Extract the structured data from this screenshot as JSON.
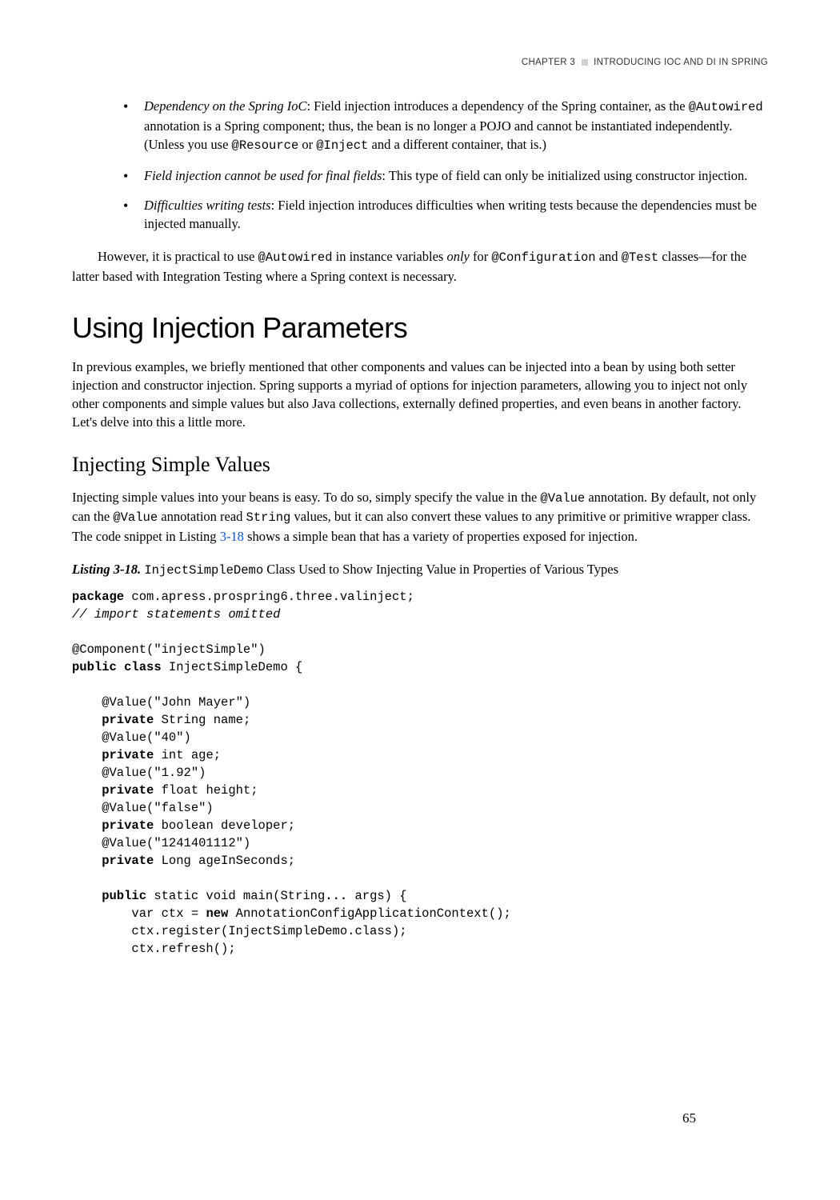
{
  "header": {
    "chapter_prefix": "CHAPTER 3",
    "chapter_title": "INTRODUCING IOC AND DI IN SPRING"
  },
  "bullets": [
    {
      "term": "Dependency on the Spring IoC",
      "text_before_code1": ": Field injection introduces a dependency of the Spring container, as the ",
      "code1": "@Autowired",
      "text_mid": " annotation is a Spring component; thus, the bean is no longer a POJO and cannot be instantiated independently. (Unless you use ",
      "code2": "@Resource",
      "text_mid2": " or ",
      "code3": "@Inject",
      "text_after": " and a different container, that is.)"
    },
    {
      "term": "Field injection cannot be used for final fields",
      "text_after": ": This type of field can only be initialized using constructor injection."
    },
    {
      "term": "Difficulties writing tests",
      "text_after": ": Field injection introduces difficulties when writing tests because the dependencies must be injected manually."
    }
  ],
  "para1": {
    "t1": "However, it is practical to use ",
    "c1": "@Autowired",
    "t2": " in instance variables ",
    "i1": "only",
    "t3": " for ",
    "c2": "@Configuration",
    "t4": " and ",
    "c3": "@Test",
    "t5": " classes—for the latter based with Integration Testing where a Spring context is necessary."
  },
  "h1": "Using Injection Parameters",
  "para2": "In previous examples, we briefly mentioned that other components and values can be injected into a bean by using both setter injection and constructor injection. Spring supports a myriad of options for injection parameters, allowing you to inject not only other components and simple values but also Java collections, externally defined properties, and even beans in another factory. Let's delve into this a little more.",
  "h2": "Injecting Simple Values",
  "para3": {
    "t1": "Injecting simple values into your beans is easy. To do so, simply specify the value in the ",
    "c1": "@Value",
    "t2": " annotation. By default, not only can the ",
    "c2": "@Value",
    "t3": " annotation read ",
    "c3": "String",
    "t4": " values, but it can also convert these values to any primitive or primitive wrapper class. The code snippet in Listing ",
    "link": "3-18",
    "t5": " shows a simple bean that has a variety of properties exposed for injection."
  },
  "listing": {
    "label": "Listing 3-18.",
    "code_class": "InjectSimpleDemo",
    "caption_rest": " Class Used to Show Injecting Value in Properties of Various Types"
  },
  "code": {
    "l1a": "package",
    "l1b": " com.apress.prospring6.three.valinject;",
    "l2": "// import statements omitted",
    "l3": "@Component(\"injectSimple\")",
    "l4a": "public class",
    "l4b": " InjectSimpleDemo {",
    "l5": "    @Value(\"John Mayer\")",
    "l6a": "    private",
    "l6b": " String name;",
    "l7": "    @Value(\"40\")",
    "l8a": "    private",
    "l8b": " int age;",
    "l9": "    @Value(\"1.92\")",
    "l10a": "    private",
    "l10b": " float height;",
    "l11": "    @Value(\"false\")",
    "l12a": "    private",
    "l12b": " boolean developer;",
    "l13": "    @Value(\"1241401112\")",
    "l14a": "    private",
    "l14b": " Long ageInSeconds;",
    "l15a": "    public",
    "l15b": " static void main(String",
    "l15c": "...",
    "l15d": " args) {",
    "l16a": "        var ctx = ",
    "l16b": "new",
    "l16c": " AnnotationConfigApplicationContext();",
    "l17": "        ctx.register(InjectSimpleDemo.class);",
    "l18": "        ctx.refresh();"
  },
  "page_number": "65"
}
